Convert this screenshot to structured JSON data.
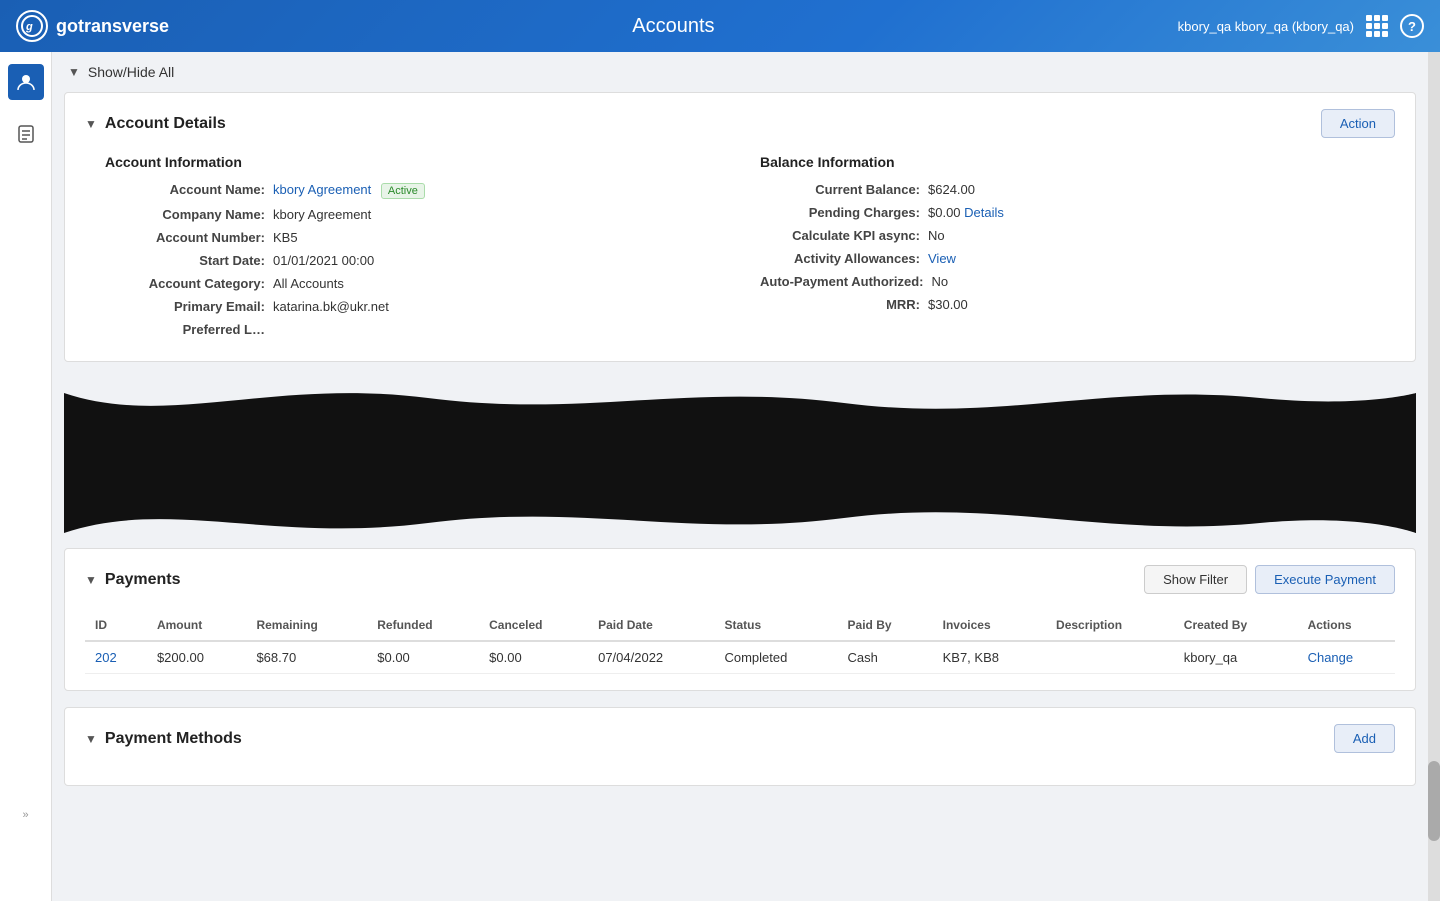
{
  "header": {
    "logo_text": "gotransverse",
    "logo_icon": "g",
    "page_title": "Accounts",
    "user_label": "kbory_qa kbory_qa (kbory_qa)",
    "help_label": "?",
    "grid_icon": "grid"
  },
  "sidebar": {
    "items": [
      {
        "name": "users",
        "icon": "👤",
        "active": true
      },
      {
        "name": "documents",
        "icon": "📋",
        "active": false
      }
    ],
    "collapse_label": "»"
  },
  "show_hide": {
    "label": "Show/Hide All",
    "arrow": "▼"
  },
  "account_details": {
    "section_title": "Account Details",
    "action_button": "Action",
    "arrow": "▼",
    "account_info": {
      "title": "Account Information",
      "fields": [
        {
          "label": "Account Name:",
          "value": "kbory Agreement",
          "link": true,
          "badge": "Active"
        },
        {
          "label": "Company Name:",
          "value": "kbory Agreement",
          "link": false
        },
        {
          "label": "Account Number:",
          "value": "KB5",
          "link": false
        },
        {
          "label": "Start Date:",
          "value": "01/01/2021 00:00",
          "link": false
        },
        {
          "label": "Account Category:",
          "value": "All Accounts",
          "link": false
        },
        {
          "label": "Primary Email:",
          "value": "katarina.bk@ukr.net",
          "link": false
        },
        {
          "label": "Preferred L…",
          "value": "",
          "link": false
        }
      ]
    },
    "balance_info": {
      "title": "Balance Information",
      "fields": [
        {
          "label": "Current Balance:",
          "value": "$624.00",
          "link": false
        },
        {
          "label": "Pending Charges:",
          "value": "$0.00",
          "extra": "Details",
          "extra_link": true
        },
        {
          "label": "Calculate KPI async:",
          "value": "No",
          "link": false
        },
        {
          "label": "Activity Allowances:",
          "value": "View",
          "link": true
        },
        {
          "label": "Auto-Payment Authorized:",
          "value": "No",
          "link": false
        },
        {
          "label": "MRR:",
          "value": "$30.00",
          "link": false
        }
      ]
    }
  },
  "payments": {
    "section_title": "Payments",
    "arrow": "▼",
    "show_filter_btn": "Show Filter",
    "execute_payment_btn": "Execute Payment",
    "table": {
      "columns": [
        "ID",
        "Amount",
        "Remaining",
        "Refunded",
        "Canceled",
        "Paid Date",
        "Status",
        "Paid By",
        "Invoices",
        "Description",
        "Created By",
        "Actions"
      ],
      "rows": [
        {
          "id": "202",
          "amount": "$200.00",
          "remaining": "$68.70",
          "refunded": "$0.00",
          "canceled": "$0.00",
          "paid_date": "07/04/2022",
          "status": "Completed",
          "paid_by": "Cash",
          "invoices": "KB7, KB8",
          "description": "",
          "created_by": "kbory_qa",
          "actions": "Change"
        }
      ]
    }
  },
  "payment_methods": {
    "section_title": "Payment Methods",
    "arrow": "▼",
    "add_button": "Add"
  }
}
